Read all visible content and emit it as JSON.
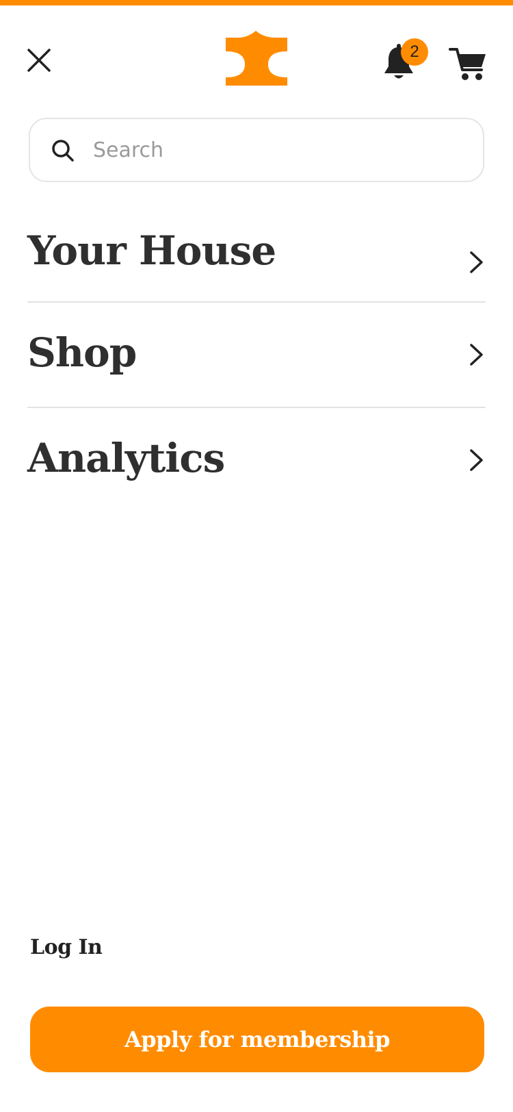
{
  "header": {
    "logo_icon": "brand-logo-icon",
    "close_icon": "close-icon",
    "bell_icon": "bell-icon",
    "cart_icon": "cart-icon",
    "notification_count": "2"
  },
  "search": {
    "placeholder": "Search",
    "value": "",
    "icon": "search-icon"
  },
  "menu": {
    "items": [
      {
        "label": "Your House",
        "icon": "chevron-right-icon"
      },
      {
        "label": "Shop",
        "icon": "chevron-right-icon"
      },
      {
        "label": "Analytics",
        "icon": "chevron-right-icon"
      }
    ]
  },
  "footer": {
    "login_label": "Log In",
    "apply_label": "Apply for membership"
  },
  "colors": {
    "accent": "#ff8c00",
    "text": "#2f2f2f",
    "divider": "#e2e2e2",
    "placeholder": "#9a9a9a"
  }
}
